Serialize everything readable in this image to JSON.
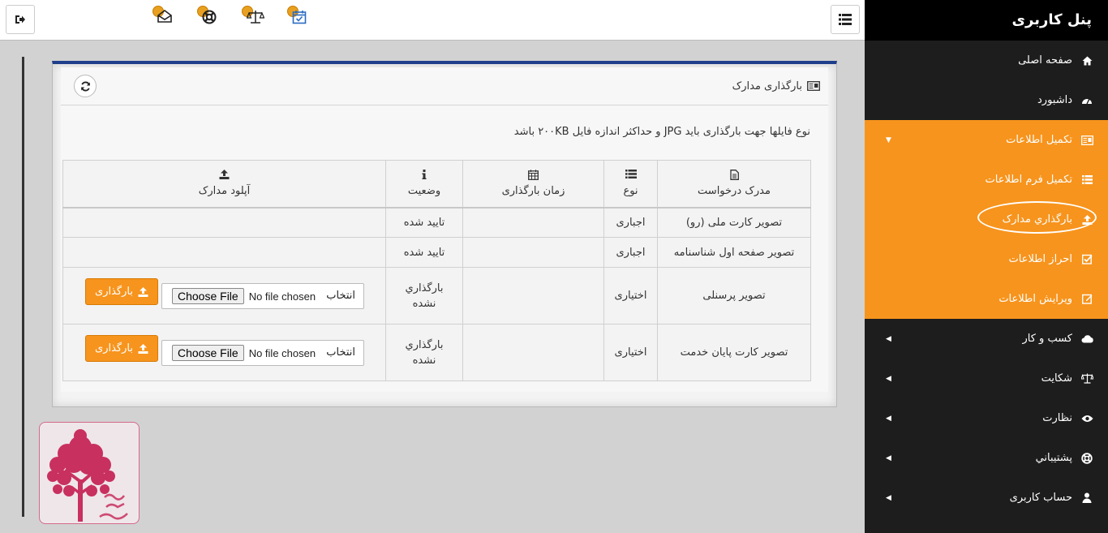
{
  "sidebar": {
    "title": "پنل کاربری",
    "items": [
      {
        "label": "صفحه اصلی",
        "icon": "home-icon"
      },
      {
        "label": "داشبورد",
        "icon": "dashboard-icon"
      },
      {
        "label": "تکمیل اطلاعات",
        "icon": "id-card-icon"
      },
      {
        "label": "کسب و کار",
        "icon": "cloud-icon"
      },
      {
        "label": "شکایت",
        "icon": "balance-scale-icon"
      },
      {
        "label": "نظارت",
        "icon": "eye-icon"
      },
      {
        "label": "پشتيباني",
        "icon": "life-ring-icon"
      },
      {
        "label": "حساب کاربری",
        "icon": "user-icon"
      }
    ],
    "submenu": [
      {
        "label": "تکمیل فرم اطلاعات",
        "icon": "list-icon"
      },
      {
        "label": "بارگذاري مدارک",
        "icon": "upload-icon"
      },
      {
        "label": "احراز اطلاعات",
        "icon": "check-square-icon"
      },
      {
        "label": "ویرایش اطلاعات",
        "icon": "pencil-icon"
      }
    ]
  },
  "panel": {
    "title": "بارگذاری مدارک",
    "info": "نوع فایلها جهت بارگذاری باید JPG و حداکثر اندازه فایل ۲۰۰KB باشد"
  },
  "table": {
    "headers": [
      "مدرک درخواست",
      "نوع",
      "زمان بارگذاری",
      "وضعیت",
      "آپلود مدارک"
    ],
    "rows": [
      {
        "doc": "تصویر کارت ملی (رو)",
        "type": "اجباری",
        "time": "",
        "status": "تایید شده"
      },
      {
        "doc": "تصویر صفحه اول شناسنامه",
        "type": "اجباری",
        "time": "",
        "status": "تایید شده"
      },
      {
        "doc": "تصویر پرسنلی",
        "type": "اختیاری",
        "time": "",
        "status": "بارگذاري نشده"
      },
      {
        "doc": "تصویر کارت پایان خدمت",
        "type": "اختیاری",
        "time": "",
        "status": "بارگذاري نشده"
      }
    ],
    "file_input": {
      "button": "Choose File",
      "no_file": "No file chosen",
      "label": "انتخاب"
    },
    "upload_button": "بارگذاری"
  },
  "colors": {
    "accent": "#f7941d",
    "sidebar": "#1d1d1d",
    "panel_border": "#1f3f8b"
  }
}
